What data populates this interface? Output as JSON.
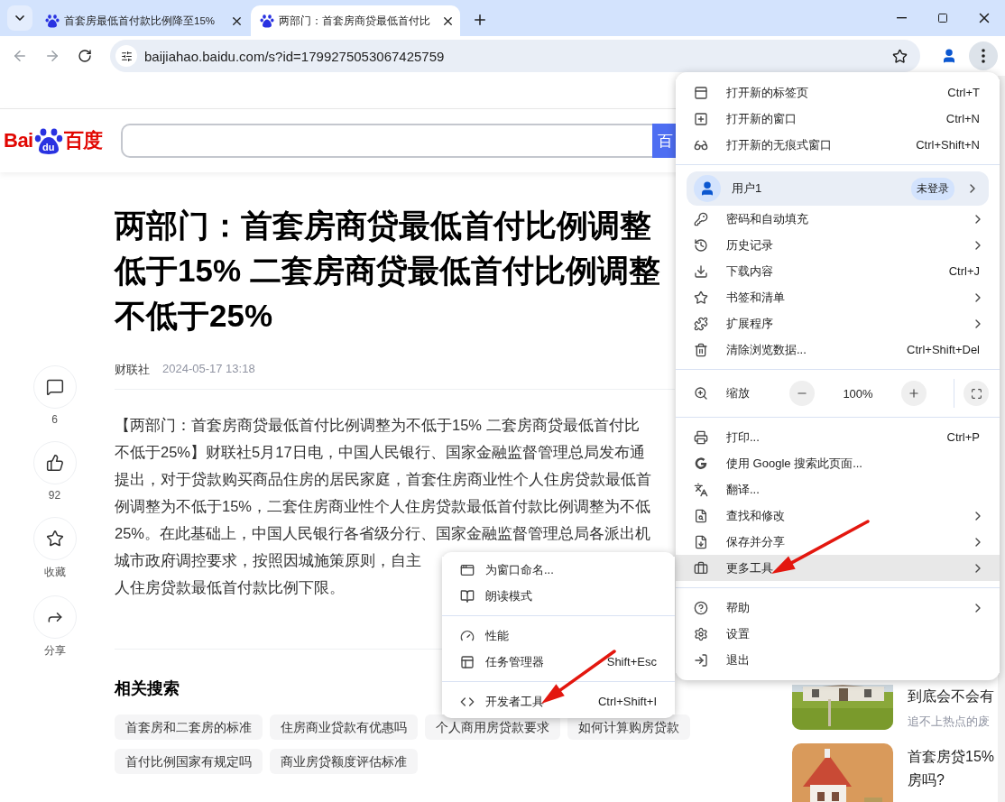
{
  "tabs": [
    {
      "title": "首套房最低首付款比例降至15%",
      "selected": false
    },
    {
      "title": "两部门：首套房商贷最低首付比",
      "selected": true
    }
  ],
  "address_bar": {
    "url": "baijiahao.baidu.com/s?id=1799275053067425759"
  },
  "baidu_header": {
    "logo_latin": "Bai",
    "logo_badge": "du",
    "logo_cjk": "百度",
    "search_button": "百"
  },
  "actions": [
    {
      "kind": "comment",
      "label": "6"
    },
    {
      "kind": "like",
      "label": "92"
    },
    {
      "kind": "favorite",
      "label": "收藏"
    },
    {
      "kind": "share",
      "label": "分享"
    }
  ],
  "article": {
    "title_lines": [
      "两部门：首套房商贷最低首付比例调整",
      "低于15% 二套房商贷最低首付比例调整",
      "不低于25%"
    ],
    "source": "财联社",
    "time": "2024-05-17 13:18",
    "body_lines": [
      "【两部门：首套房商贷最低首付比例调整为不低于15% 二套房商贷最低首付比",
      "不低于25%】财联社5月17日电，中国人民银行、国家金融监督管理总局发布通",
      "提出，对于贷款购买商品住房的居民家庭，首套住房商业性个人住房贷款最低首",
      "例调整为不低于15%，二套住房商业性个人住房贷款最低首付款比例调整为不低",
      "25%。在此基础上，中国人民银行各省级分行、国家金融监督管理总局各派出机",
      "城市政府调控要求，按照因城施策原则，自主",
      "人住房贷款最低首付款比例下限。"
    ]
  },
  "related": {
    "title": "相关搜索",
    "tags": [
      "首套房和二套房的标准",
      "住房商业贷款有优惠吗",
      "个人商用房贷款要求",
      "如何计算购房贷款",
      "首付比例国家有规定吗",
      "商业房贷额度评估标准"
    ]
  },
  "side_cards": [
    {
      "kind": "picture",
      "title_lines": [
        "到底会不会有"
      ],
      "subtitle": "追不上热点的废"
    },
    {
      "kind": "picture",
      "title_lines": [
        "首套房贷15%",
        "房吗?"
      ]
    }
  ],
  "menu": {
    "sections": [
      {
        "items": [
          {
            "kind": "item",
            "label": "打开新的标签页",
            "shortcut": "Ctrl+T",
            "has_submenu": false,
            "highlighted": false
          },
          {
            "kind": "item",
            "label": "打开新的窗口",
            "shortcut": "Ctrl+N",
            "has_submenu": false,
            "highlighted": false
          },
          {
            "kind": "item",
            "label": "打开新的无痕式窗口",
            "shortcut": "Ctrl+Shift+N",
            "has_submenu": false,
            "highlighted": false
          }
        ]
      },
      {
        "items": [
          {
            "kind": "profile",
            "label": "用户1",
            "badge": "未登录",
            "has_submenu": true,
            "highlighted": false
          },
          {
            "kind": "item",
            "label": "密码和自动填充",
            "has_submenu": true,
            "highlighted": false
          },
          {
            "kind": "item",
            "label": "历史记录",
            "has_submenu": true,
            "highlighted": false
          },
          {
            "kind": "item",
            "label": "下载内容",
            "shortcut": "Ctrl+J",
            "has_submenu": false,
            "highlighted": false
          },
          {
            "kind": "item",
            "label": "书签和清单",
            "has_submenu": true,
            "highlighted": false
          },
          {
            "kind": "item",
            "label": "扩展程序",
            "has_submenu": true,
            "highlighted": false
          },
          {
            "kind": "item",
            "label": "清除浏览数据...",
            "shortcut": "Ctrl+Shift+Del",
            "has_submenu": false,
            "highlighted": false
          }
        ]
      },
      {
        "items": [
          {
            "kind": "zoom",
            "label": "缩放",
            "value": "100%"
          }
        ]
      },
      {
        "items": [
          {
            "kind": "item",
            "label": "打印...",
            "shortcut": "Ctrl+P",
            "has_submenu": false,
            "highlighted": false
          },
          {
            "kind": "item",
            "label": "使用 Google 搜索此页面...",
            "has_submenu": false,
            "highlighted": false
          },
          {
            "kind": "item",
            "label": "翻译...",
            "has_submenu": false,
            "highlighted": false
          },
          {
            "kind": "item",
            "label": "查找和修改",
            "has_submenu": true,
            "highlighted": false
          },
          {
            "kind": "item",
            "label": "保存并分享",
            "has_submenu": true,
            "highlighted": false
          },
          {
            "kind": "item",
            "label": "更多工具",
            "has_submenu": true,
            "highlighted": true
          }
        ]
      },
      {
        "items": [
          {
            "kind": "item",
            "label": "帮助",
            "has_submenu": true,
            "highlighted": false
          },
          {
            "kind": "item",
            "label": "设置",
            "has_submenu": false,
            "highlighted": false
          },
          {
            "kind": "item",
            "label": "退出",
            "has_submenu": false,
            "highlighted": false
          }
        ]
      }
    ]
  },
  "submenu": {
    "sections": [
      {
        "items": [
          {
            "label": "为窗口命名...",
            "highlighted": false
          },
          {
            "label": "朗读模式",
            "highlighted": false
          }
        ]
      },
      {
        "items": [
          {
            "label": "性能",
            "highlighted": false
          },
          {
            "label": "任务管理器",
            "shortcut": "Shift+Esc",
            "highlighted": false
          }
        ]
      },
      {
        "items": [
          {
            "label": "开发者工具",
            "shortcut": "Ctrl+Shift+I",
            "highlighted": false
          }
        ]
      }
    ]
  }
}
